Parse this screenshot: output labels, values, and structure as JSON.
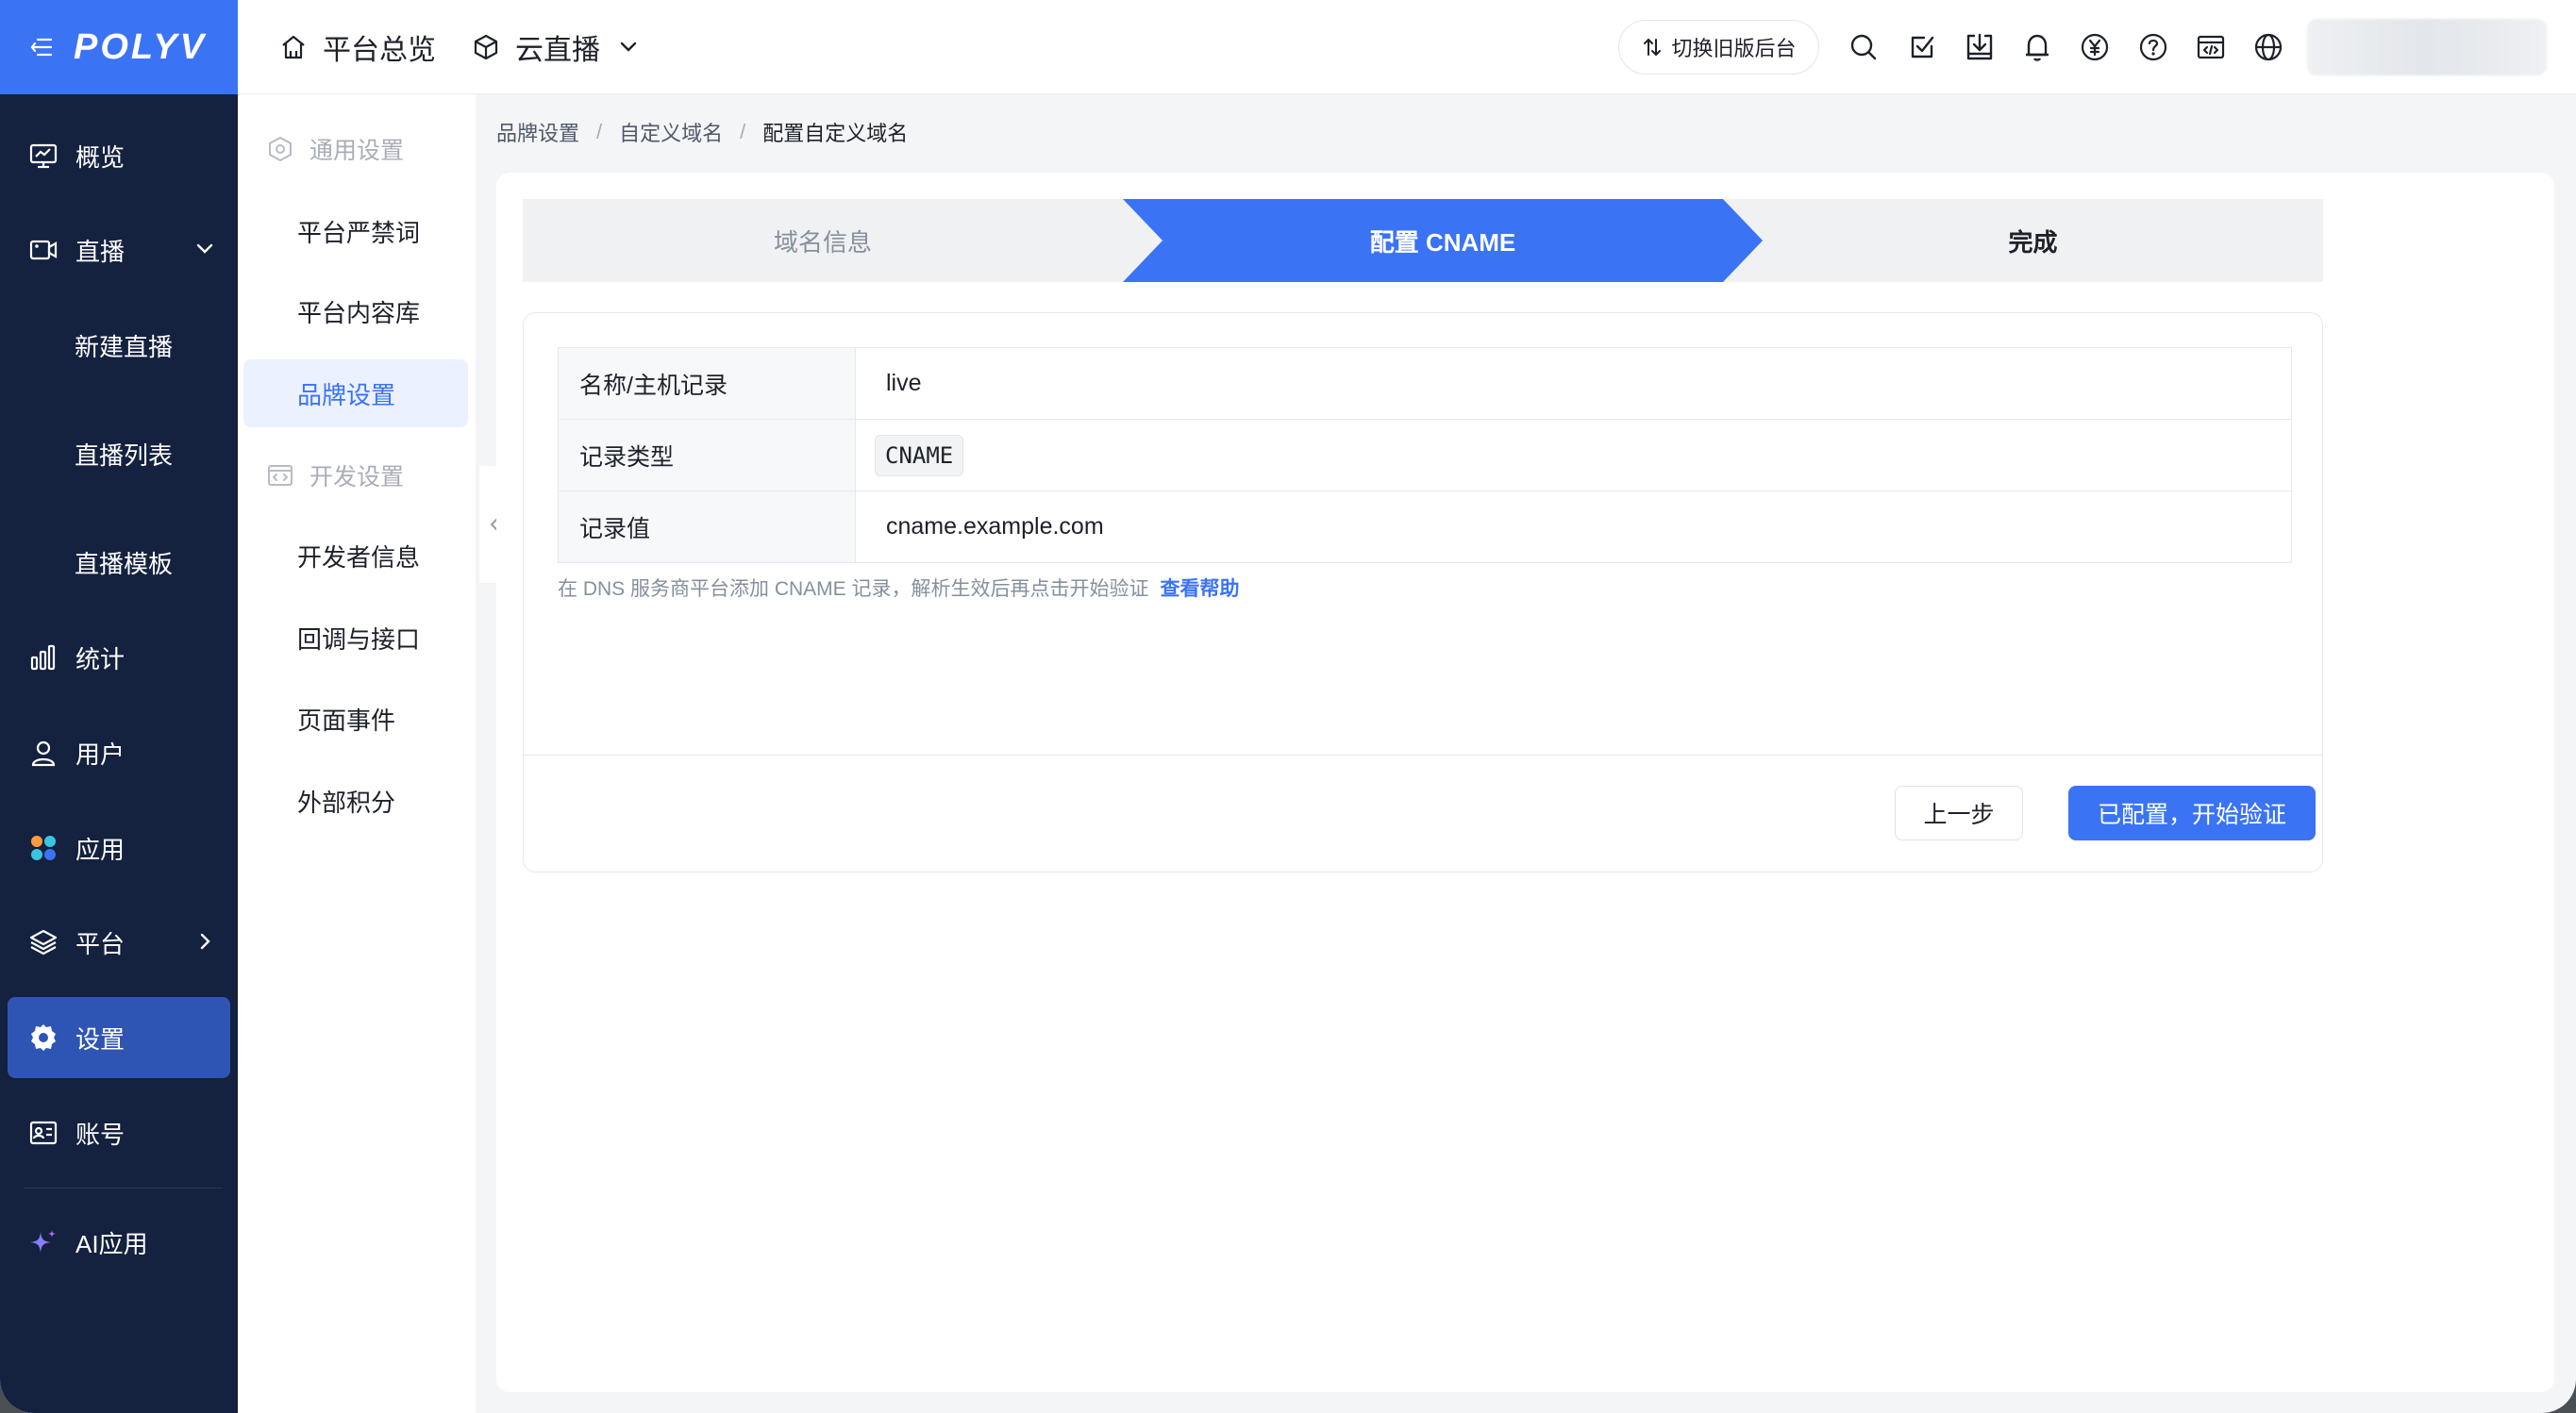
{
  "brand": {
    "logo_text": "POLYV",
    "accent": "#3b73f5",
    "sidebar_bg": "#14213f"
  },
  "sidebar": {
    "items": [
      {
        "label": "概览",
        "icon": "monitor-icon"
      },
      {
        "label": "直播",
        "icon": "video-camera-icon",
        "expanded": true
      },
      {
        "label": "新建直播"
      },
      {
        "label": "直播列表"
      },
      {
        "label": "直播模板"
      },
      {
        "label": "统计",
        "icon": "bar-chart-icon"
      },
      {
        "label": "用户",
        "icon": "user-icon"
      },
      {
        "label": "应用",
        "icon": "apps-icon"
      },
      {
        "label": "平台",
        "icon": "layers-icon"
      },
      {
        "label": "设置",
        "icon": "gear-icon",
        "active": true
      },
      {
        "label": "账号",
        "icon": "id-card-icon"
      },
      {
        "label": "AI应用",
        "icon": "sparkle-icon"
      }
    ]
  },
  "header": {
    "nav": [
      {
        "label": "平台总览",
        "icon": "home-icon"
      },
      {
        "label": "云直播",
        "icon": "cube-icon"
      }
    ],
    "switch_label": "切换旧版后台",
    "icons": [
      "search-icon",
      "check-square-icon",
      "download-icon",
      "bell-icon",
      "yen-icon",
      "help-icon",
      "code-window-icon",
      "globe-icon"
    ]
  },
  "submenu": {
    "general_title": "通用设置",
    "general_items": [
      "平台严禁词",
      "平台内容库",
      "品牌设置"
    ],
    "dev_title": "开发设置",
    "dev_items": [
      "开发者信息",
      "回调与接口",
      "页面事件",
      "外部积分"
    ]
  },
  "breadcrumb": [
    "品牌设置",
    "自定义域名",
    "配置自定义域名"
  ],
  "steps": [
    {
      "label": "域名信息",
      "state": "done"
    },
    {
      "label": "配置 CNAME",
      "state": "active"
    },
    {
      "label": "完成",
      "state": "pending"
    }
  ],
  "dns": {
    "rows": [
      {
        "key": "名称/主机记录",
        "value": "live"
      },
      {
        "key": "记录类型",
        "value": "CNAME"
      },
      {
        "key": "记录值",
        "value": "cname.example.com"
      }
    ],
    "hint": "在 DNS 服务商平台添加 CNAME 记录，解析生效后再点击开始验证",
    "help_link": "查看帮助"
  },
  "actions": {
    "prev": "上一步",
    "verify": "已配置，开始验证"
  }
}
